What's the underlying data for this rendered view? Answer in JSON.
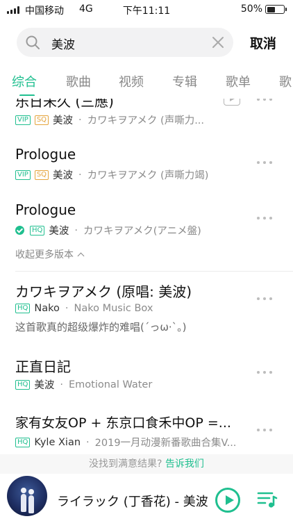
{
  "status_bar": {
    "carrier": "中国移动",
    "network": "4G",
    "time": "下午11:11",
    "battery": "50%",
    "battery_level": 0.5
  },
  "search": {
    "query": "美波",
    "cancel_label": "取消"
  },
  "tabs": [
    "综合",
    "歌曲",
    "视频",
    "专辑",
    "歌单",
    "歌"
  ],
  "active_tab": 0,
  "results": [
    {
      "title": "乐日未久 (三應)",
      "badges": [
        "VIP",
        "SQ"
      ],
      "artist": "美波",
      "info": "カワキヲアメク (声嘶力...",
      "has_mv": true
    },
    {
      "title": "Prologue",
      "badges": [
        "VIP",
        "SQ"
      ],
      "artist": "美波",
      "info": "カワキヲアメク (声嘶力竭)",
      "has_mv": false
    },
    {
      "title": "Prologue",
      "badges": [
        "HQ"
      ],
      "downloaded": true,
      "artist": "美波",
      "info": "カワキヲアメク(アニメ盤)",
      "has_mv": false
    },
    {
      "title": "カワキヲアメク (原唱: 美波)",
      "badges": [
        "HQ"
      ],
      "artist": "Nako",
      "info": "Nako Music Box",
      "comment": "这首歌真的超级爆炸的难唱(´っω·`。)",
      "has_mv": false
    },
    {
      "title": "正直日記",
      "badges": [
        "HQ"
      ],
      "artist": "美波",
      "info": "Emotional Water",
      "has_mv": false
    },
    {
      "title": "家有女友OP + 东京口食禾中OP =...",
      "badges": [
        "HQ"
      ],
      "artist": "Kyle Xian",
      "info": "2019一月动漫新番歌曲合集V...",
      "has_mv": false
    }
  ],
  "collapse_label": "收起更多版本",
  "feedback": {
    "prompt": "没找到满意结果?",
    "link": "告诉我们"
  },
  "player": {
    "now_playing": "ライラック (丁香花) - 美波"
  },
  "colors": {
    "accent": "#1fbf8f",
    "sq": "#e5a43c"
  }
}
